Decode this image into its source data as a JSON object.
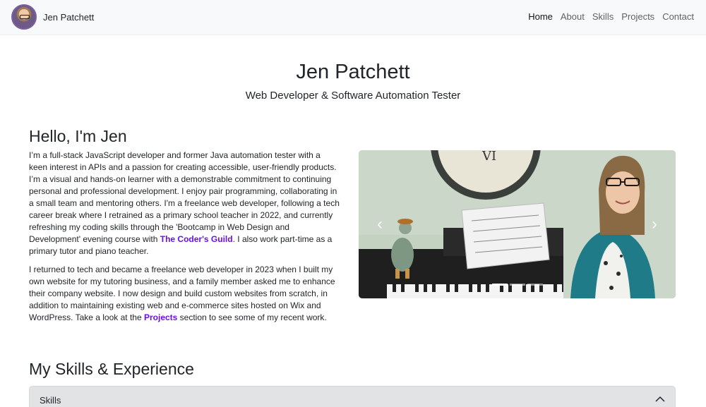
{
  "nav": {
    "brand": "Jen Patchett",
    "links": [
      "Home",
      "About",
      "Skills",
      "Projects",
      "Contact"
    ]
  },
  "hero": {
    "title": "Jen Patchett",
    "subtitle": "Web Developer & Software Automation Tester"
  },
  "about": {
    "heading": "Hello, I'm Jen",
    "p1_a": "I’m a full-stack JavaScript developer and former Java automation tester with a keen interest in APIs and a passion for creating accessible, user-friendly products. I’m a visual and hands-on learner with a demonstrable commitment to continuing personal and professional development. I enjoy pair programming, collaborating in a small team and mentoring others. I'm a freelance web developer, following a tech career break where I retrained as a primary school teacher in 2022, and currently refreshing my coding skills through the 'Bootcamp in Web Design and Development' evening course with ",
    "p1_link": "The Coder's Guild",
    "p1_b": ". I also work part-time as a primary tutor and piano teacher.",
    "p2_a": "I returned to tech and became a freelance web developer in 2023 when I built my own website for my tutoring business, and a family member asked me to enhance their company website. I now design and build custom websites from scratch, in addition to maintaining existing web and e-commerce sites hosted on Wix and WordPress. Take a look at the ",
    "p2_link": "Projects",
    "p2_b": " section to see some of my recent work."
  },
  "carousel": {
    "prev_icon": "chevron-left-icon",
    "next_icon": "chevron-right-icon",
    "slides": 3,
    "active_slide": 1
  },
  "skills": {
    "heading": "My Skills & Experience",
    "accordion_label": "Skills"
  },
  "colors": {
    "navbar_bg": "#f8f9fa",
    "link": "#6610f2",
    "accordion_bg": "#e2e3e5"
  }
}
